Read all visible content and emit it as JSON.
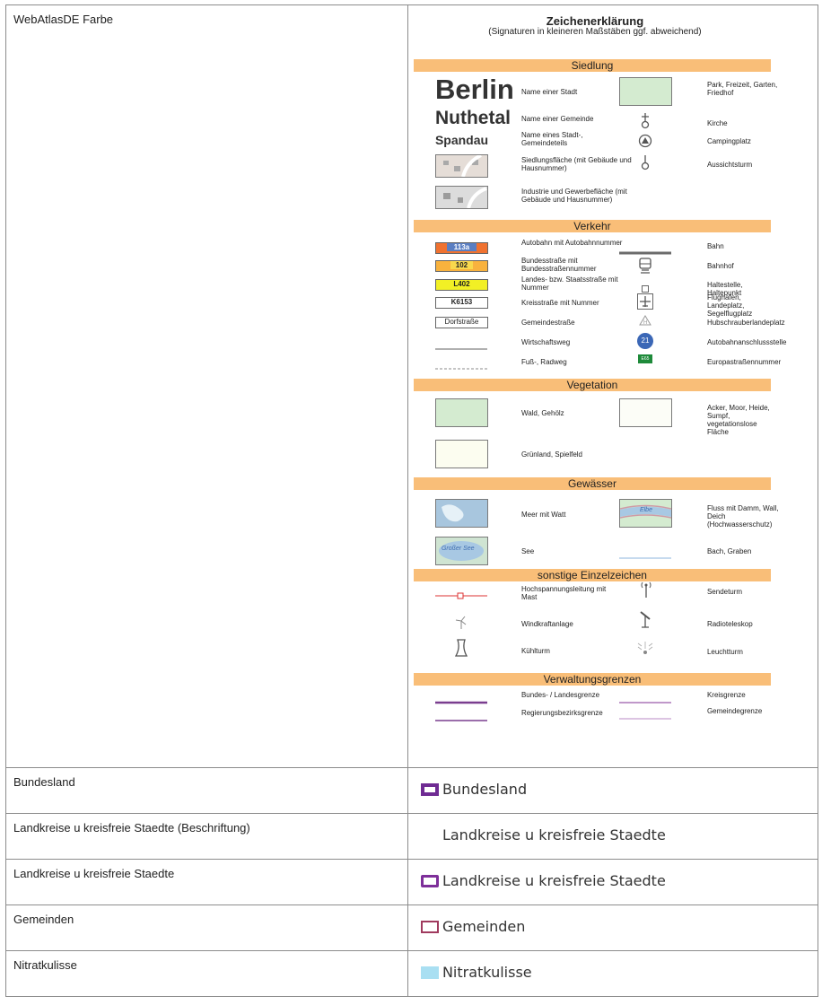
{
  "rows": [
    {
      "name": "WebAtlasDE Farbe"
    },
    {
      "name": "Bundesland",
      "legend_label": "Bundesland"
    },
    {
      "name": "Landkreise u kreisfreie Staedte (Beschriftung)",
      "legend_label": "Landkreise u kreisfreie Staedte"
    },
    {
      "name": "Landkreise u kreisfreie Staedte",
      "legend_label": "Landkreise u kreisfreie Staedte"
    },
    {
      "name": "Gemeinden",
      "legend_label": "Gemeinden"
    },
    {
      "name": "Nitratkulisse",
      "legend_label": "Nitratkulisse"
    }
  ],
  "legend": {
    "title": "Zeichenerklärung",
    "subtitle": "(Signaturen in kleineren Maßstäben ggf. abweichend)",
    "sections": {
      "siedlung": "Siedlung",
      "verkehr": "Verkehr",
      "vegetation": "Vegetation",
      "gewaesser": "Gewässer",
      "sonstige": "sonstige Einzelzeichen",
      "verwaltung": "Verwaltungsgrenzen"
    },
    "siedlung": {
      "berlin": "Berlin",
      "berlin_label": "Name einer Stadt",
      "nuthetal": "Nuthetal",
      "nuthetal_label": "Name einer Gemeinde",
      "spandau": "Spandau",
      "spandau_label": "Name eines Stadt-, Gemeindeteils",
      "siedlungsflaeche": "Siedlungsfläche (mit Gebäude und Hausnummer)",
      "industrie": "Industrie und Gewerbefläche (mit Gebäude und Hausnummer)",
      "park": "Park, Freizeit, Garten, Friedhof",
      "kirche": "Kirche",
      "camping": "Campingplatz",
      "aussichtsturm": "Aussichtsturm"
    },
    "verkehr": {
      "autobahn_num": "113a",
      "autobahn": "Autobahn mit Autobahnnummer",
      "bundes_num": "102",
      "bundes": "Bundesstraße mit Bundesstraßennummer",
      "landes_num": "L402",
      "landes": "Landes- bzw. Staatsstraße mit Nummer",
      "kreis_num": "K6153",
      "kreis": "Kreisstraße mit Nummer",
      "gemeinde_name": "Dorfstraße",
      "gemeinde": "Gemeindestraße",
      "wirtschaft": "Wirtschaftsweg",
      "fuss": "Fuß-, Radweg",
      "bahn": "Bahn",
      "bahnhof": "Bahnhof",
      "halt": "Haltestelle, Haltepunkt",
      "flughafen": "Flughafen, Landeplatz, Segelflugplatz",
      "heli": "Hubschrauberlandeplatz",
      "anschluss_num": "21",
      "anschluss": "Autobahnanschlussstelle",
      "europa_num": "E65",
      "europa": "Europastraßennummer"
    },
    "vegetation": {
      "wald": "Wald, Gehölz",
      "gruen": "Grünland, Spielfeld",
      "acker": "Acker, Moor, Heide, Sumpf, vegetationslose Fläche"
    },
    "gewaesser": {
      "meer": "Meer mit Watt",
      "see_name": "Großer See",
      "see": "See",
      "fluss_name": "Elbe",
      "fluss": "Fluss mit Damm, Wall, Deich (Hochwasserschutz)",
      "bach": "Bach, Graben"
    },
    "sonstige": {
      "hochspannung": "Hochspannungsleitung mit Mast",
      "wind": "Windkraftanlage",
      "kuehl": "Kühlturm",
      "sende": "Sendeturm",
      "radio": "Radioteleskop",
      "leucht": "Leuchtturm"
    },
    "verwaltung": {
      "bundes": "Bundes- / Landesgrenze",
      "reg": "Regierungsbezirksgrenze",
      "kreis": "Kreisgrenze",
      "gemeinde": "Gemeindegrenze"
    }
  },
  "colors": {
    "section": "#f9be78",
    "purple": "#6f2b93",
    "gemeinden": "#a03a5e",
    "nitrat": "#a9dff2"
  }
}
